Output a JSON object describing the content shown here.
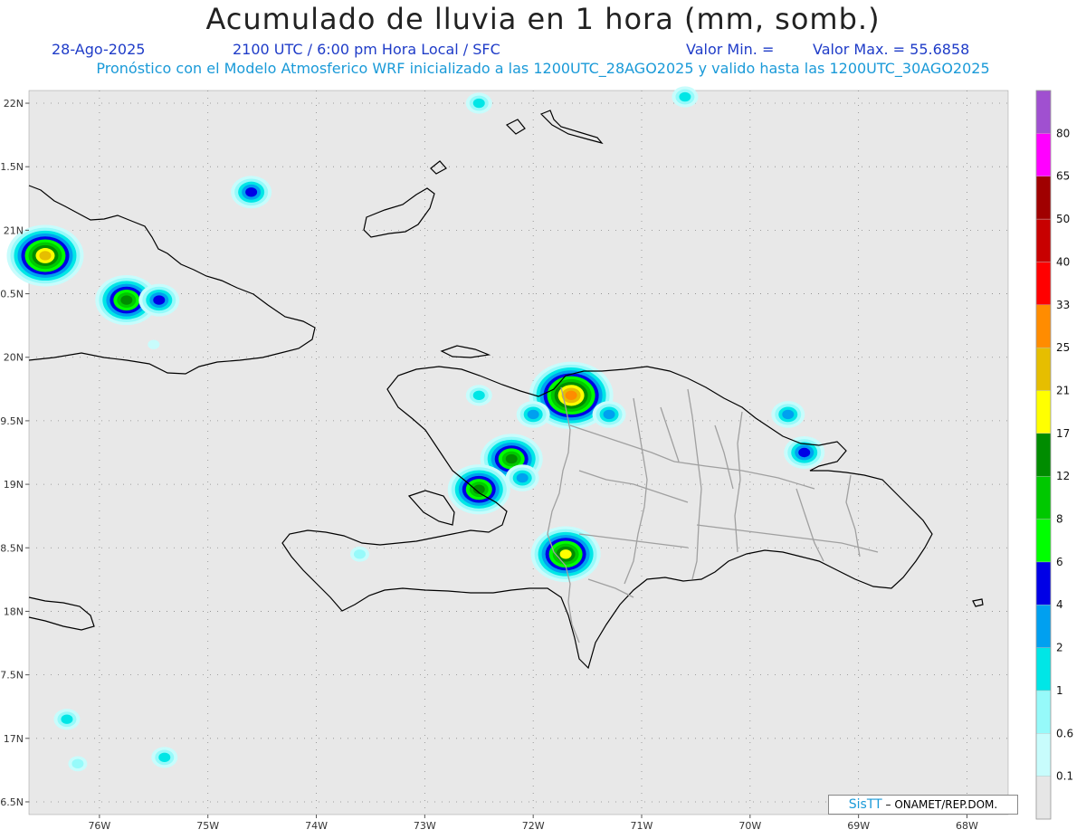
{
  "title": "Acumulado de lluvia en 1 hora (mm, somb.)",
  "date": "28-Ago-2025",
  "time": "2100 UTC / 6:00 pm Hora Local / SFC",
  "min_label": "Valor Min. =",
  "max_label": "Valor Max. = 55.6858",
  "model_line": "Pronóstico con el Modelo Atmosferico WRF inicializado a las 1200UTC_28AGO2025 y valido hasta las  1200UTC_30AGO2025",
  "credit_brand": "SisTT",
  "credit_text": " – ONAMET/REP.DOM.",
  "map": {
    "lon_range": [
      -76.6,
      -67.6
    ],
    "lat_range": [
      16.4,
      22.1
    ],
    "lon_ticks": [
      "76W",
      "75W",
      "74W",
      "73W",
      "72W",
      "71W",
      "70W",
      "69W",
      "68W"
    ],
    "lat_ticks": [
      "22N",
      "1.5N",
      "21N",
      "0.5N",
      "20N",
      "9.5N",
      "19N",
      "8.5N",
      "18N",
      "7.5N",
      "17N",
      "6.5N"
    ],
    "background_color": "#e8e8e8",
    "coast_color": "#000000",
    "border_color": "#a0a0a0"
  },
  "colorbar": {
    "labels": [
      "0.1",
      "0.6",
      "1",
      "2",
      "4",
      "6",
      "8",
      "12",
      "17",
      "21",
      "25",
      "33",
      "40",
      "50",
      "65",
      "80"
    ],
    "colors": [
      "#e6e6e6",
      "#c8fcfc",
      "#96fafa",
      "#00e6e6",
      "#00a0f0",
      "#0000e6",
      "#00ff00",
      "#00c800",
      "#008c00",
      "#ffff00",
      "#e6be00",
      "#ff8c00",
      "#ff0000",
      "#c80000",
      "#a00000",
      "#ff00ff",
      "#a050d0"
    ]
  },
  "rain_cells": [
    {
      "lon": -71.65,
      "lat": 19.7,
      "level": 11
    },
    {
      "lon": -72.2,
      "lat": 19.2,
      "level": 8
    },
    {
      "lon": -72.5,
      "lat": 18.96,
      "level": 8
    },
    {
      "lon": -71.7,
      "lat": 18.45,
      "level": 9
    },
    {
      "lon": -75.75,
      "lat": 20.45,
      "level": 8
    },
    {
      "lon": -76.5,
      "lat": 20.8,
      "level": 10
    },
    {
      "lon": -75.45,
      "lat": 20.45,
      "level": 5
    },
    {
      "lon": -74.6,
      "lat": 21.3,
      "level": 5
    },
    {
      "lon": -69.5,
      "lat": 19.25,
      "level": 5
    },
    {
      "lon": -69.65,
      "lat": 19.55,
      "level": 4
    },
    {
      "lon": -72.0,
      "lat": 19.55,
      "level": 4
    },
    {
      "lon": -72.5,
      "lat": 19.7,
      "level": 3
    },
    {
      "lon": -72.5,
      "lat": 22.0,
      "level": 3
    },
    {
      "lon": -70.6,
      "lat": 22.05,
      "level": 3
    },
    {
      "lon": -76.3,
      "lat": 17.15,
      "level": 3
    },
    {
      "lon": -75.4,
      "lat": 16.85,
      "level": 3
    },
    {
      "lon": -76.2,
      "lat": 16.8,
      "level": 2
    },
    {
      "lon": -73.6,
      "lat": 18.45,
      "level": 2
    },
    {
      "lon": -72.1,
      "lat": 19.05,
      "level": 4
    },
    {
      "lon": -71.3,
      "lat": 19.55,
      "level": 4
    },
    {
      "lon": -75.5,
      "lat": 20.1,
      "level": 1
    }
  ]
}
